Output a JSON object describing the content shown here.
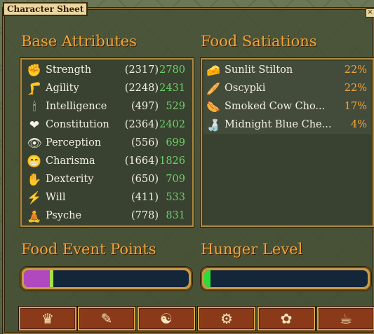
{
  "window": {
    "title": "Character Sheet",
    "close": "×"
  },
  "attributes": {
    "title": "Base Attributes",
    "rows": [
      {
        "name": "Strength",
        "base": "(2317)",
        "value": "2780",
        "icon": "strength-icon",
        "glyph": "✊"
      },
      {
        "name": "Agility",
        "base": "(2248)",
        "value": "2431",
        "icon": "agility-icon",
        "glyph": "🦵"
      },
      {
        "name": "Intelligence",
        "base": "(497)",
        "value": "529",
        "icon": "intelligence-icon",
        "glyph": "🕯"
      },
      {
        "name": "Constitution",
        "base": "(2364)",
        "value": "2402",
        "icon": "constitution-icon",
        "glyph": "❤"
      },
      {
        "name": "Perception",
        "base": "(556)",
        "value": "699",
        "icon": "perception-icon",
        "glyph": "👁"
      },
      {
        "name": "Charisma",
        "base": "(1664)",
        "value": "1826",
        "icon": "charisma-icon",
        "glyph": "😁"
      },
      {
        "name": "Dexterity",
        "base": "(650)",
        "value": "709",
        "icon": "dexterity-icon",
        "glyph": "✋"
      },
      {
        "name": "Will",
        "base": "(411)",
        "value": "533",
        "icon": "will-icon",
        "glyph": "⚡"
      },
      {
        "name": "Psyche",
        "base": "(778)",
        "value": "831",
        "icon": "psyche-icon",
        "glyph": "🧘"
      }
    ]
  },
  "food": {
    "title": "Food Satiations",
    "rows": [
      {
        "name": "Sunlit Stilton",
        "pct": "22%",
        "icon": "cheese-icon",
        "glyph": "🧀"
      },
      {
        "name": "Oscypki",
        "pct": "22%",
        "icon": "oscypek-icon",
        "glyph": "🥖"
      },
      {
        "name": "Smoked Cow Cho...",
        "pct": "17%",
        "icon": "sausage-icon",
        "glyph": "🌭"
      },
      {
        "name": "Midnight Blue Che...",
        "pct": "4%",
        "icon": "blue-cheese-icon",
        "glyph": "🍶"
      }
    ]
  },
  "fep": {
    "title": "Food Event Points",
    "fill_fraction": 0.18,
    "fill_color": "#b048c0"
  },
  "hunger": {
    "title": "Hunger Level",
    "fill_fraction": 0.04,
    "fill_color": "#2edc3a"
  },
  "tabs": [
    {
      "name": "tab-attributes-crown",
      "glyph": "♛"
    },
    {
      "name": "tab-skills",
      "glyph": "✎"
    },
    {
      "name": "tab-beliefs",
      "glyph": "☯"
    },
    {
      "name": "tab-study",
      "glyph": "⚙"
    },
    {
      "name": "tab-wounds",
      "glyph": "✿"
    },
    {
      "name": "tab-quests",
      "glyph": "☕"
    }
  ]
}
